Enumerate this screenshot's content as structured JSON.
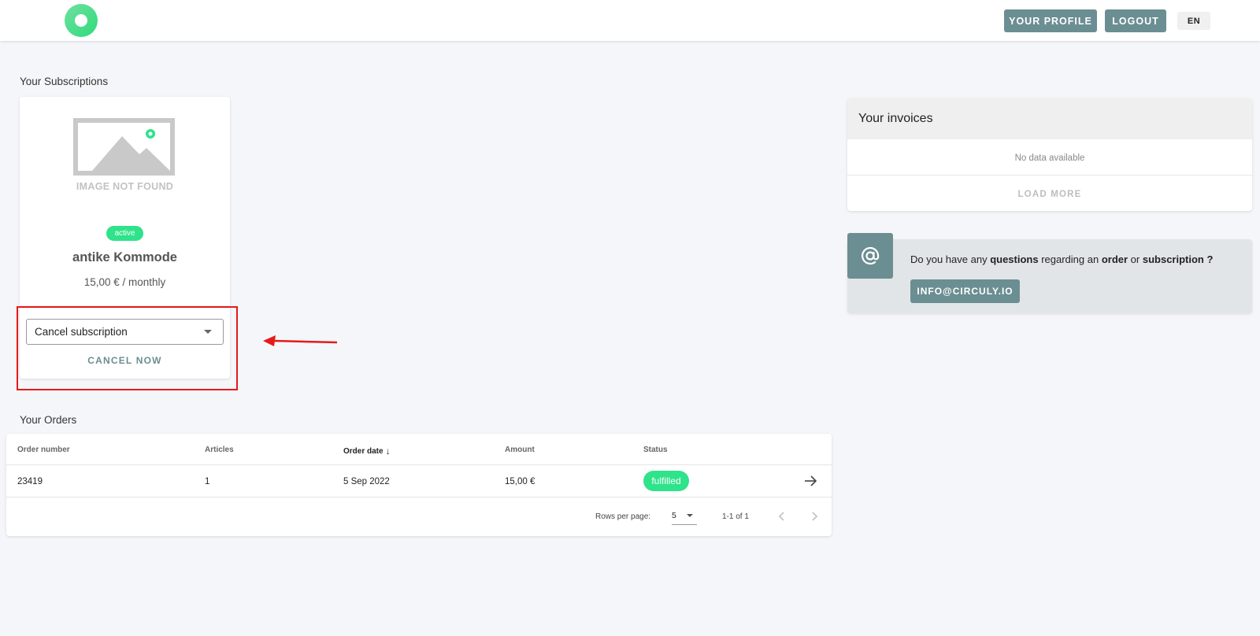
{
  "header": {
    "logo_icon": "circle-logo-icon",
    "profile_label": "YOUR PROFILE",
    "logout_label": "LOGOUT",
    "language_label": "EN"
  },
  "subscriptions": {
    "section_title": "Your Subscriptions",
    "items": [
      {
        "image_placeholder_text": "IMAGE NOT FOUND",
        "status": "active",
        "name": "antike Kommode",
        "price": "15,00 € / monthly",
        "action_select_value": "Cancel subscription",
        "action_button_label": "CANCEL NOW"
      }
    ]
  },
  "orders": {
    "section_title": "Your Orders",
    "columns": [
      "Order number",
      "Articles",
      "Order date",
      "Amount",
      "Status"
    ],
    "sorted_column": "Order date",
    "rows": [
      {
        "order_number": "23419",
        "articles": "1",
        "order_date": "5 Sep 2022",
        "amount": "15,00 €",
        "status": "fulfilled"
      }
    ],
    "pagination": {
      "rows_per_page_label": "Rows per page:",
      "rows_per_page_value": "5",
      "range_text": "1-1 of 1"
    }
  },
  "invoices": {
    "title": "Your invoices",
    "empty_text": "No data available",
    "load_more_label": "LOAD MORE"
  },
  "contact": {
    "icon": "at-sign-icon",
    "text_parts": [
      "Do you have any ",
      "questions",
      " regarding an ",
      "order",
      " or ",
      "subscription ?"
    ],
    "email_button_label": "INFO@CIRCULY.IO"
  },
  "annotation": {
    "highlight_color": "#e51a1a"
  },
  "colors": {
    "accent": "#6b8e92",
    "status_green": "#2ee38a",
    "background": "#f5f6f9"
  }
}
